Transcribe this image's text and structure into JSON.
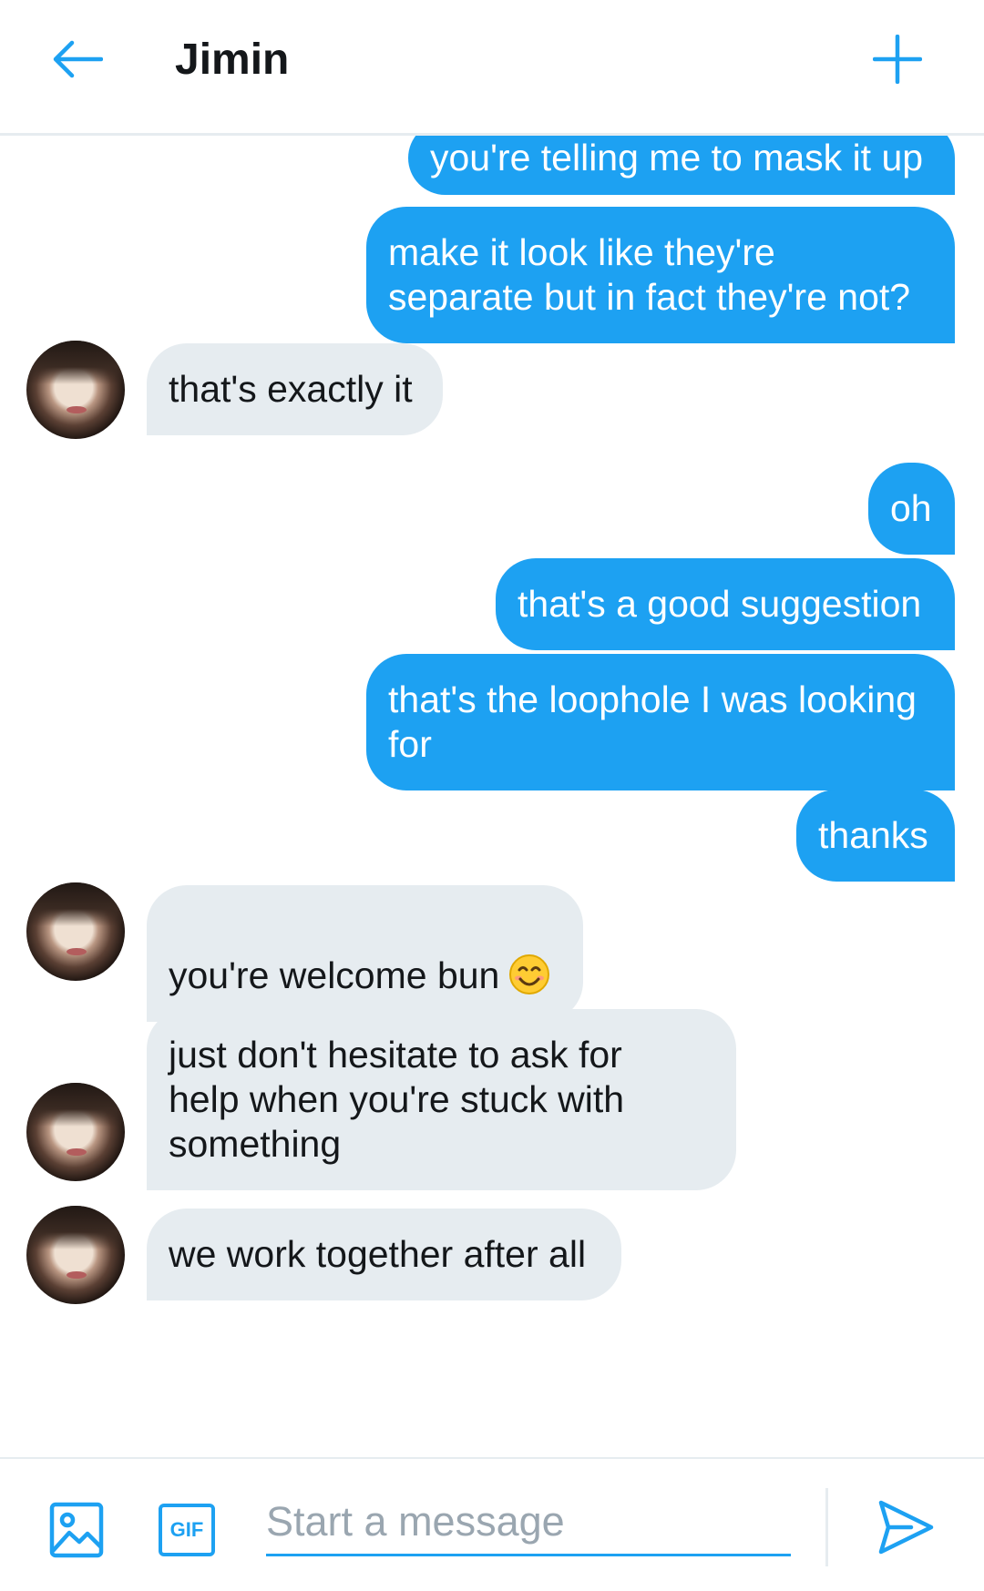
{
  "header": {
    "title": "Jimin",
    "back_icon": "arrow-left-icon",
    "new_icon": "plus-icon"
  },
  "messages": [
    {
      "direction": "out",
      "text": "you're telling me to mask it up"
    },
    {
      "direction": "out",
      "text": "make it look like they're\nseparate but in fact they're not?"
    },
    {
      "direction": "in",
      "text": "that's exactly it"
    },
    {
      "direction": "out",
      "text": "oh"
    },
    {
      "direction": "out",
      "text": "that's a good suggestion"
    },
    {
      "direction": "out",
      "text": "that's the loophole I was looking\nfor"
    },
    {
      "direction": "out",
      "text": "thanks"
    },
    {
      "direction": "in",
      "text": "you're welcome bun",
      "emoji": "smiling-face-icon"
    },
    {
      "direction": "in",
      "text": "just don't hesitate to ask for\nhelp when you're stuck with\nsomething"
    },
    {
      "direction": "in",
      "text": "we work together after all"
    }
  ],
  "composer": {
    "placeholder": "Start a message",
    "value": "",
    "image_icon": "image-icon",
    "gif_label": "GIF",
    "send_icon": "send-icon"
  },
  "colors": {
    "accent": "#1da1f2",
    "incoming_bubble": "#e6ecf0",
    "text": "#14171a"
  }
}
